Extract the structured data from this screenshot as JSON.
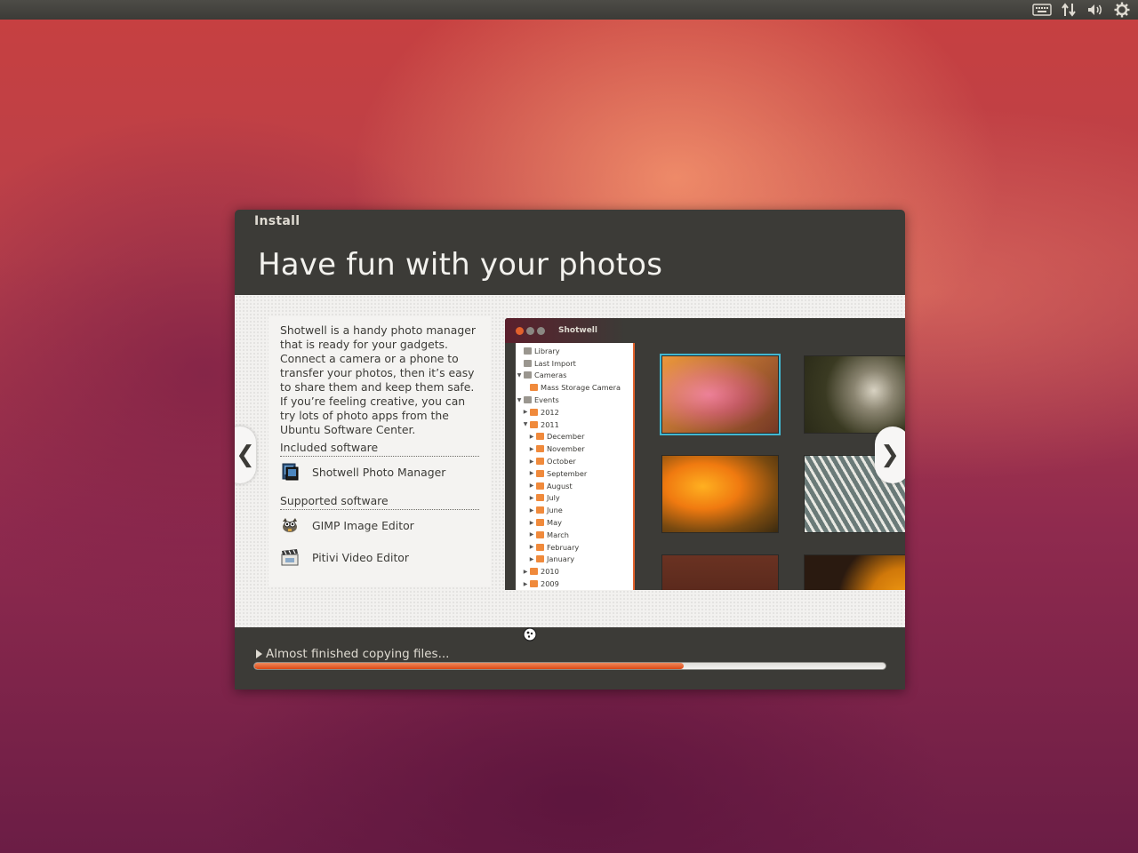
{
  "top_panel": {
    "icons": [
      "keyboard-icon",
      "network-icon",
      "volume-icon",
      "system-gear-icon"
    ]
  },
  "window": {
    "title": "Install"
  },
  "slide": {
    "title": "Have fun with your photos",
    "description": "Shotwell is a handy photo manager that is ready for your gadgets. Connect a camera or a phone to transfer your photos, then it’s easy to share them and keep them safe. If you’re feeling creative, you can try lots of photo apps from the Ubuntu Software Center.",
    "included_heading": "Included software",
    "included": [
      {
        "name": "Shotwell Photo Manager",
        "icon": "shotwell-icon"
      }
    ],
    "supported_heading": "Supported software",
    "supported": [
      {
        "name": "GIMP Image Editor",
        "icon": "gimp-icon"
      },
      {
        "name": "Pitivi Video Editor",
        "icon": "pitivi-icon"
      }
    ],
    "prev_glyph": "❮",
    "next_glyph": "❯"
  },
  "screenshot": {
    "app_title": "Shotwell",
    "tree": [
      {
        "label": "Library",
        "indent": 0,
        "arrow": ""
      },
      {
        "label": "Last Import",
        "indent": 0,
        "arrow": ""
      },
      {
        "label": "Cameras",
        "indent": 0,
        "arrow": "▼"
      },
      {
        "label": "Mass Storage Camera",
        "indent": 1,
        "arrow": ""
      },
      {
        "label": "Events",
        "indent": 0,
        "arrow": "▼"
      },
      {
        "label": "2012",
        "indent": 1,
        "arrow": "▶"
      },
      {
        "label": "2011",
        "indent": 1,
        "arrow": "▼"
      },
      {
        "label": "December",
        "indent": 2,
        "arrow": "▶"
      },
      {
        "label": "November",
        "indent": 2,
        "arrow": "▶"
      },
      {
        "label": "October",
        "indent": 2,
        "arrow": "▶"
      },
      {
        "label": "September",
        "indent": 2,
        "arrow": "▶"
      },
      {
        "label": "August",
        "indent": 2,
        "arrow": "▶"
      },
      {
        "label": "July",
        "indent": 2,
        "arrow": "▶"
      },
      {
        "label": "June",
        "indent": 2,
        "arrow": "▶"
      },
      {
        "label": "May",
        "indent": 2,
        "arrow": "▶"
      },
      {
        "label": "March",
        "indent": 2,
        "arrow": "▶"
      },
      {
        "label": "February",
        "indent": 2,
        "arrow": "▶"
      },
      {
        "label": "January",
        "indent": 2,
        "arrow": "▶"
      },
      {
        "label": "2010",
        "indent": 1,
        "arrow": "▶"
      },
      {
        "label": "2009",
        "indent": 1,
        "arrow": "▶"
      }
    ]
  },
  "status": {
    "text": "Almost finished copying files...",
    "progress_fraction": 0.68
  },
  "colors": {
    "accent": "#dd4814",
    "selection": "#41b7d1",
    "panel_dark": "#3c3b37"
  }
}
